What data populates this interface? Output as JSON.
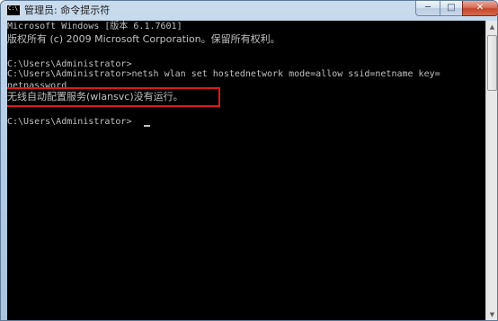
{
  "window": {
    "icon_label": "C:\\",
    "title": "管理员: 命令提示符",
    "minimize_glyph": "─",
    "maximize_glyph": "□",
    "close_glyph": "✕"
  },
  "console": {
    "lines": [
      "Microsoft Windows [版本 6.1.7601]",
      "版权所有 (c) 2009 Microsoft Corporation。保留所有权利。",
      "",
      "C:\\Users\\Administrator>",
      "C:\\Users\\Administrator>netsh wlan set hostednetwork mode=allow ssid=netname key=",
      "netpassword",
      "无线自动配置服务(wlansvc)没有运行。",
      "",
      "C:\\Users\\Administrator>"
    ]
  },
  "scrollbar": {
    "up_glyph": "▲",
    "down_glyph": "▼"
  },
  "colors": {
    "console_background": "#000000",
    "console_text": "#c0c0c0",
    "highlight_border": "#e01818",
    "close_button": "#c2462c"
  },
  "icons": [
    "cmd-app-icon",
    "minimize-icon",
    "maximize-icon",
    "close-icon",
    "scroll-up-icon",
    "scroll-down-icon"
  ]
}
